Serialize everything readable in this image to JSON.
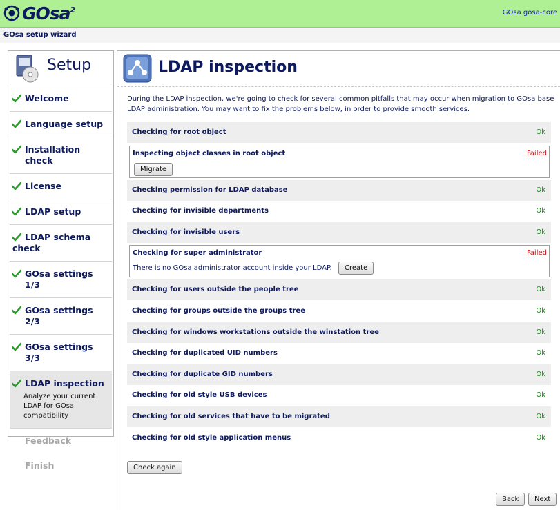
{
  "header": {
    "logo_text": "GOsa",
    "logo_sup": "2",
    "server_label": "GOsa gosa-core"
  },
  "subbar": {
    "title": "GOsa setup wizard"
  },
  "sidebar": {
    "title": "Setup",
    "steps": [
      {
        "label": "Welcome",
        "state": "done"
      },
      {
        "label": "Language setup",
        "state": "done"
      },
      {
        "label": "Installation check",
        "state": "done"
      },
      {
        "label": "License",
        "state": "done"
      },
      {
        "label": "LDAP setup",
        "state": "done"
      },
      {
        "label": "LDAP schema check",
        "state": "done"
      },
      {
        "label": "GOsa settings 1/3",
        "state": "done"
      },
      {
        "label": "GOsa settings 2/3",
        "state": "done"
      },
      {
        "label": "GOsa settings 3/3",
        "state": "done"
      },
      {
        "label": "LDAP inspection",
        "state": "active",
        "description": "Analyze your current LDAP for GOsa compatibility"
      },
      {
        "label": "Feedback",
        "state": "disabled"
      },
      {
        "label": "Finish",
        "state": "disabled"
      }
    ]
  },
  "main": {
    "title": "LDAP inspection",
    "intro": "During the LDAP inspection, we're going to check for several common pitfalls that may occur when migration to GOsa base LDAP administration. You may want to fix the problems below, in order to provide smooth services.",
    "checks": [
      {
        "label": "Checking for root object",
        "status": "Ok"
      },
      {
        "label": "Inspecting object classes in root object",
        "status": "Failed",
        "button": "Migrate"
      },
      {
        "label": "Checking permission for LDAP database",
        "status": "Ok"
      },
      {
        "label": "Checking for invisible departments",
        "status": "Ok"
      },
      {
        "label": "Checking for invisible users",
        "status": "Ok"
      },
      {
        "label": "Checking for super administrator",
        "status": "Failed",
        "message": "There is no GOsa administrator account inside your LDAP.",
        "button": "Create"
      },
      {
        "label": "Checking for users outside the people tree",
        "status": "Ok"
      },
      {
        "label": "Checking for groups outside the groups tree",
        "status": "Ok"
      },
      {
        "label": "Checking for windows workstations outside the winstation tree",
        "status": "Ok"
      },
      {
        "label": "Checking for duplicated UID numbers",
        "status": "Ok"
      },
      {
        "label": "Checking for duplicate GID numbers",
        "status": "Ok"
      },
      {
        "label": "Checking for old style USB devices",
        "status": "Ok"
      },
      {
        "label": "Checking for old services that have to be migrated",
        "status": "Ok"
      },
      {
        "label": "Checking for old style application menus",
        "status": "Ok"
      }
    ],
    "check_again": "Check again",
    "back": "Back",
    "next": "Next"
  },
  "colors": {
    "header_bg": "#b0f095",
    "text_blue": "#0e1a5e",
    "ok": "#0a8a0a",
    "failed": "#c41818"
  }
}
